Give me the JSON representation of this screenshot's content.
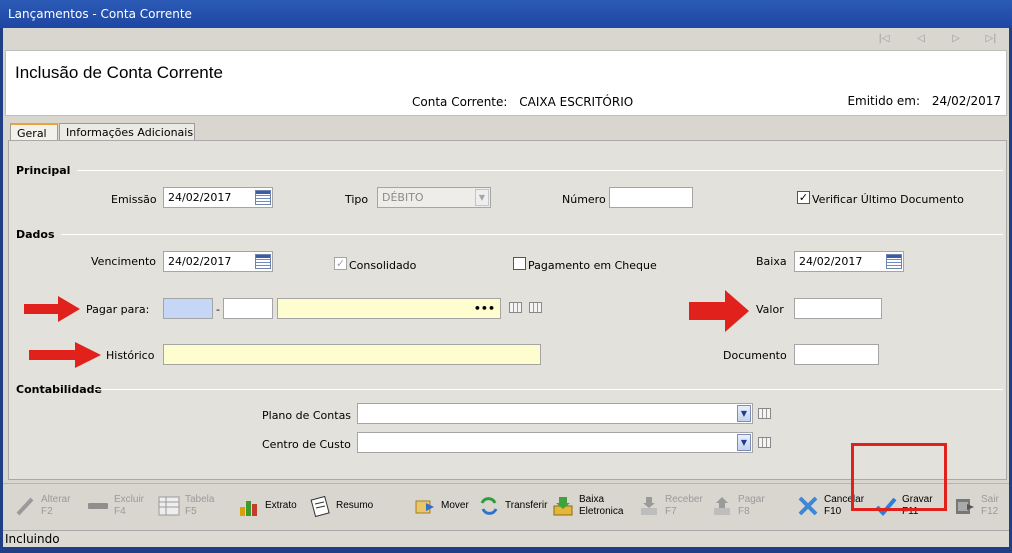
{
  "window": {
    "title": "Lançamentos - Conta Corrente"
  },
  "header": {
    "title": "Inclusão de Conta Corrente",
    "conta_corrente_label": "Conta Corrente:",
    "conta_corrente_value": "CAIXA ESCRITÓRIO",
    "emitido_label": "Emitido em:",
    "emitido_value": "24/02/2017"
  },
  "tabs": [
    {
      "label": "Geral",
      "active": true
    },
    {
      "label": "Informações Adicionais",
      "active": false
    }
  ],
  "principal": {
    "section": "Principal",
    "emissao_label": "Emissão",
    "emissao_value": "24/02/2017",
    "tipo_label": "Tipo",
    "tipo_value": "DÉBITO",
    "numero_label": "Número",
    "numero_value": "",
    "verificar_label": "Verificar Último Documento",
    "verificar_checked": true
  },
  "dados": {
    "section": "Dados",
    "vencimento_label": "Vencimento",
    "vencimento_value": "24/02/2017",
    "consolidado_label": "Consolidado",
    "consolidado_checked": true,
    "pagamento_cheque_label": "Pagamento em Cheque",
    "pagamento_cheque_checked": false,
    "baixa_label": "Baixa",
    "baixa_value": "24/02/2017",
    "pagar_para_label": "Pagar para:",
    "pagar_para_code": "",
    "pagar_para_separator": "-",
    "pagar_para_sub": "",
    "pagar_para_name": "",
    "pagar_para_more": "•••",
    "valor_label": "Valor",
    "valor_value": "",
    "historico_label": "Histórico",
    "historico_value": "",
    "documento_label": "Documento",
    "documento_value": ""
  },
  "contabilidade": {
    "section": "Contabilidade",
    "plano_label": "Plano de Contas",
    "plano_value": "",
    "centro_label": "Centro de Custo",
    "centro_value": ""
  },
  "toolbar": {
    "alterar": {
      "label": "Alterar",
      "key": "F2"
    },
    "excluir": {
      "label": "Excluir",
      "key": "F4"
    },
    "tabela": {
      "label": "Tabela",
      "key": "F5"
    },
    "extrato": {
      "label": "Extrato"
    },
    "resumo": {
      "label": "Resumo"
    },
    "mover": {
      "label": "Mover"
    },
    "transferir": {
      "label": "Transferir"
    },
    "baixa_eletronica": {
      "label": "Baixa",
      "label2": "Eletronica"
    },
    "receber": {
      "label": "Receber",
      "key": "F7"
    },
    "pagar": {
      "label": "Pagar",
      "key": "F8"
    },
    "cancelar": {
      "label": "Cancelar",
      "key": "F10"
    },
    "gravar": {
      "label": "Gravar",
      "key": "F11"
    },
    "sair": {
      "label": "Sair",
      "key": "F12"
    }
  },
  "status": {
    "text": "Incluindo"
  },
  "colors": {
    "required_field": "#fdfdd0",
    "focused_field": "#c5d6f6",
    "annotation_red": "#e0211c",
    "titlebar": "#2450ad"
  }
}
